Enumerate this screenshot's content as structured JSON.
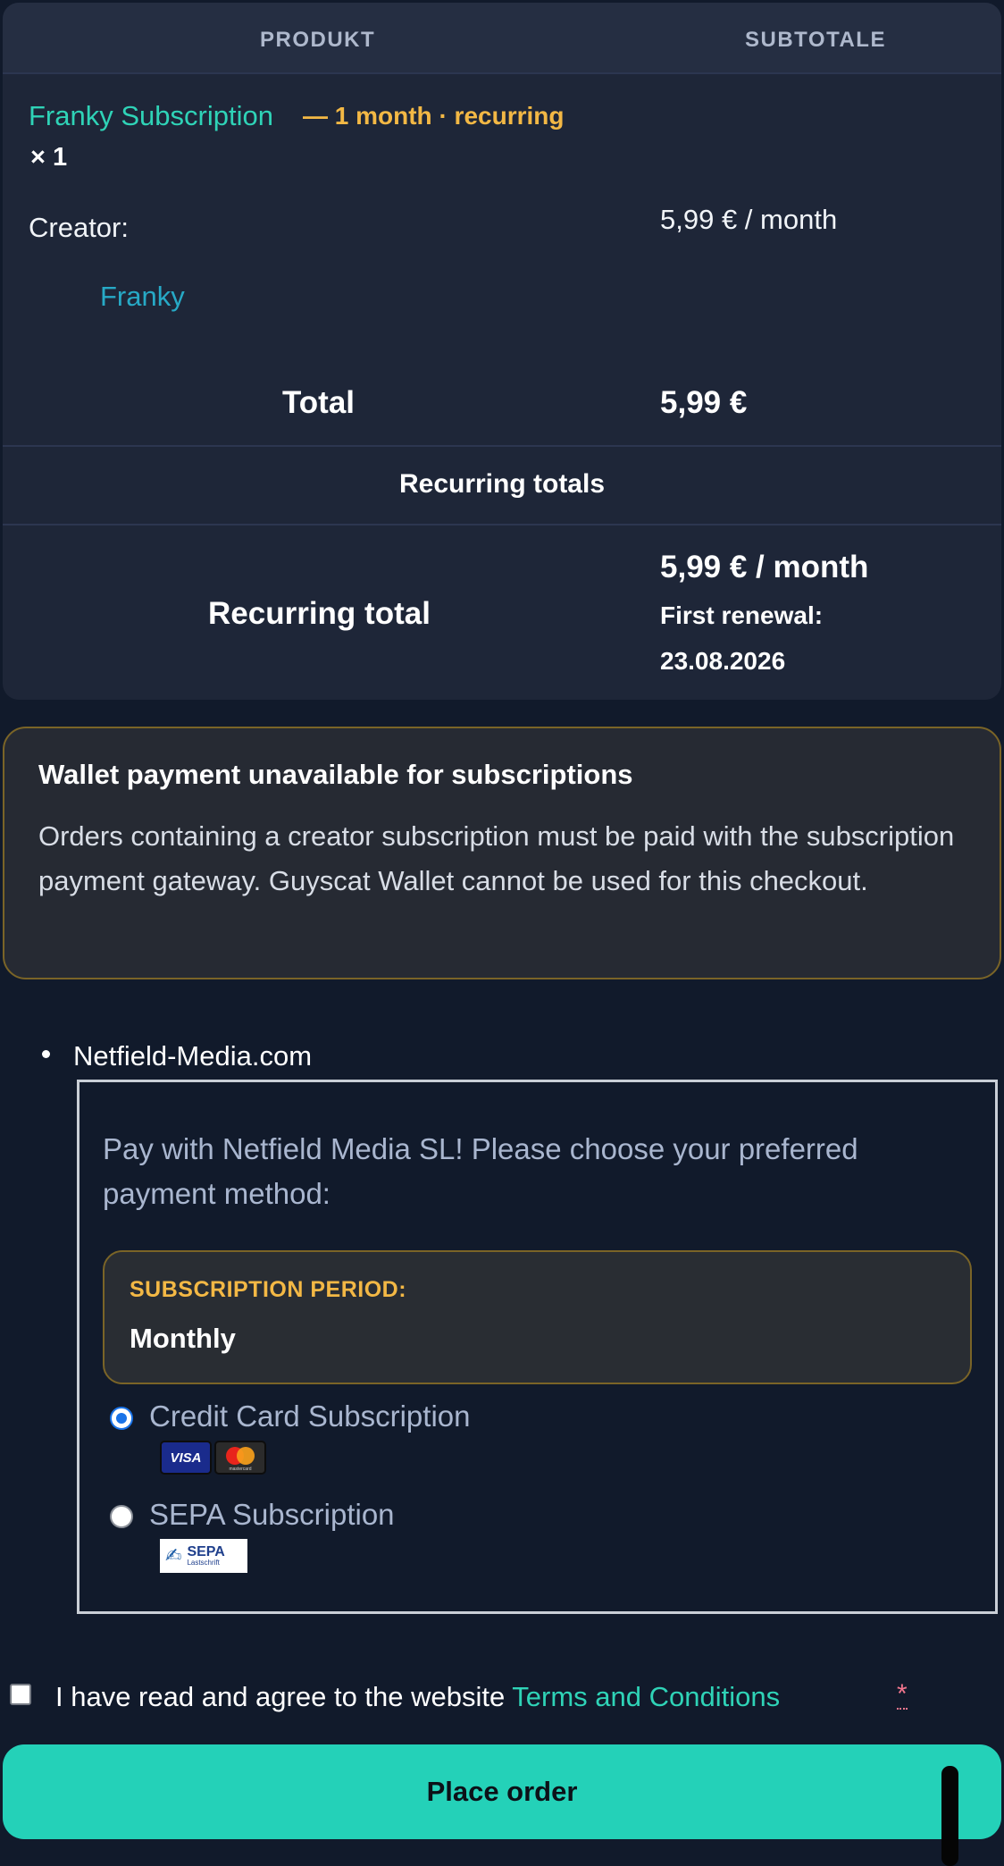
{
  "order": {
    "headers": {
      "product": "PRODUKT",
      "subtotal": "SUBTOTALE"
    },
    "item": {
      "name": "Franky Subscription",
      "meta": "— 1 month · recurring",
      "quantity": "× 1",
      "creator_label": "Creator:",
      "creator_name": "Franky",
      "price": "5,99 € / month"
    },
    "total_label": "Total",
    "total_value": "5,99 €",
    "recurring_heading": "Recurring totals",
    "recurring_total_label": "Recurring total",
    "recurring_total_value": "5,99 € / month",
    "first_renewal_label": "First renewal:",
    "first_renewal_date": "23.08.2026"
  },
  "notice": {
    "title": "Wallet payment unavailable for subscriptions",
    "body": "Orders containing a creator subscription must be paid with the subscription payment gateway. Guyscat Wallet cannot be used for this checkout."
  },
  "gateway": {
    "name": "Netfield-Media.com",
    "description": "Pay with Netfield Media SL! Please choose your preferred payment method:",
    "period_label": "SUBSCRIPTION PERIOD:",
    "period_value": "Monthly",
    "methods": [
      {
        "label": "Credit Card Subscription",
        "selected": true,
        "logos": [
          "visa-logo",
          "mastercard-logo"
        ]
      },
      {
        "label": "SEPA Subscription",
        "selected": false,
        "logos": [
          "sepa-lastschrift-logo"
        ]
      }
    ],
    "logo_text": {
      "visa": "VISA",
      "mastercard": "mastercard",
      "sepa": "SEPA",
      "sepa_sub": "Lastschrift"
    }
  },
  "terms": {
    "text": "I have read and agree to the website ",
    "link": "Terms and Conditions",
    "required_mark": "*"
  },
  "place_order_label": "Place order",
  "colors": {
    "accent": "#24d1b8",
    "highlight": "#f3b845",
    "link": "#27a9c6",
    "background": "#111a2b"
  }
}
